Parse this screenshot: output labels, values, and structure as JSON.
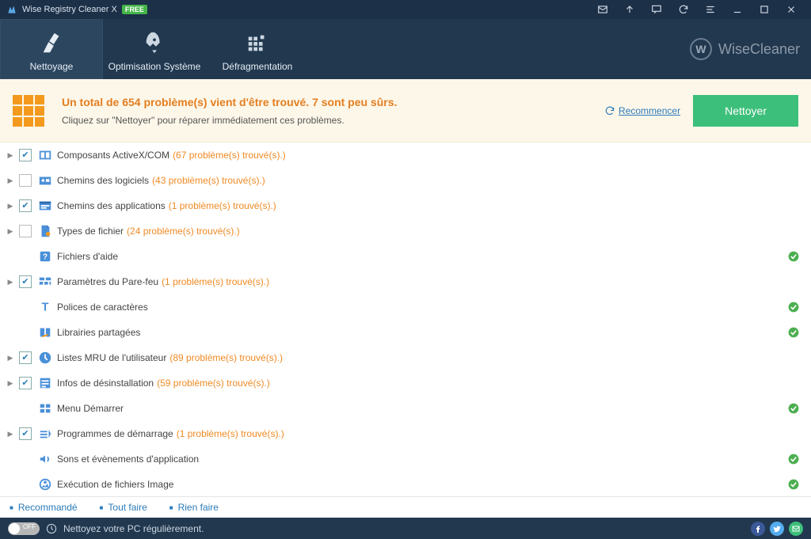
{
  "titlebar": {
    "title": "Wise Registry Cleaner X",
    "badge": "FREE"
  },
  "tabs": [
    {
      "label": "Nettoyage"
    },
    {
      "label": "Optimisation Système"
    },
    {
      "label": "Défragmentation"
    }
  ],
  "brand": "WiseCleaner",
  "banner": {
    "headline": "Un total de 654 problème(s) vient d'être trouvé. 7 sont peu sûrs.",
    "sub": "Cliquez sur \"Nettoyer\" pour réparer immédiatement ces problèmes.",
    "restart": "Recommencer",
    "clean": "Nettoyer"
  },
  "rows": [
    {
      "label": "Composants ActiveX/COM",
      "count": "(67 problème(s) trouvé(s).)",
      "exp": true,
      "checked": true
    },
    {
      "label": "Chemins des logiciels",
      "count": "(43 problème(s) trouvé(s).)",
      "exp": true,
      "checked": false
    },
    {
      "label": "Chemins des applications",
      "count": "(1 problème(s) trouvé(s).)",
      "exp": true,
      "checked": true
    },
    {
      "label": "Types de fichier",
      "count": "(24 problème(s) trouvé(s).)",
      "exp": true,
      "checked": false
    },
    {
      "label": "Fichiers d'aide",
      "ok": true
    },
    {
      "label": "Paramètres du Pare-feu",
      "count": "(1 problème(s) trouvé(s).)",
      "exp": true,
      "checked": true
    },
    {
      "label": "Polices de caractères",
      "ok": true
    },
    {
      "label": "Librairies partagées",
      "ok": true
    },
    {
      "label": "Listes MRU de l'utilisateur",
      "count": "(89 problème(s) trouvé(s).)",
      "exp": true,
      "checked": true
    },
    {
      "label": "Infos de désinstallation",
      "count": "(59 problème(s) trouvé(s).)",
      "exp": true,
      "checked": true
    },
    {
      "label": "Menu Démarrer",
      "ok": true
    },
    {
      "label": "Programmes de démarrage",
      "count": "(1 problème(s) trouvé(s).)",
      "exp": true,
      "checked": true
    },
    {
      "label": "Sons et évènements d'application",
      "ok": true
    },
    {
      "label": "Exécution de fichiers Image",
      "ok": true
    }
  ],
  "footerLinks": [
    "Recommandé",
    "Tout faire",
    "Rien faire"
  ],
  "statusbar": {
    "toggle": "OFF",
    "text": "Nettoyez votre PC régulièrement."
  }
}
